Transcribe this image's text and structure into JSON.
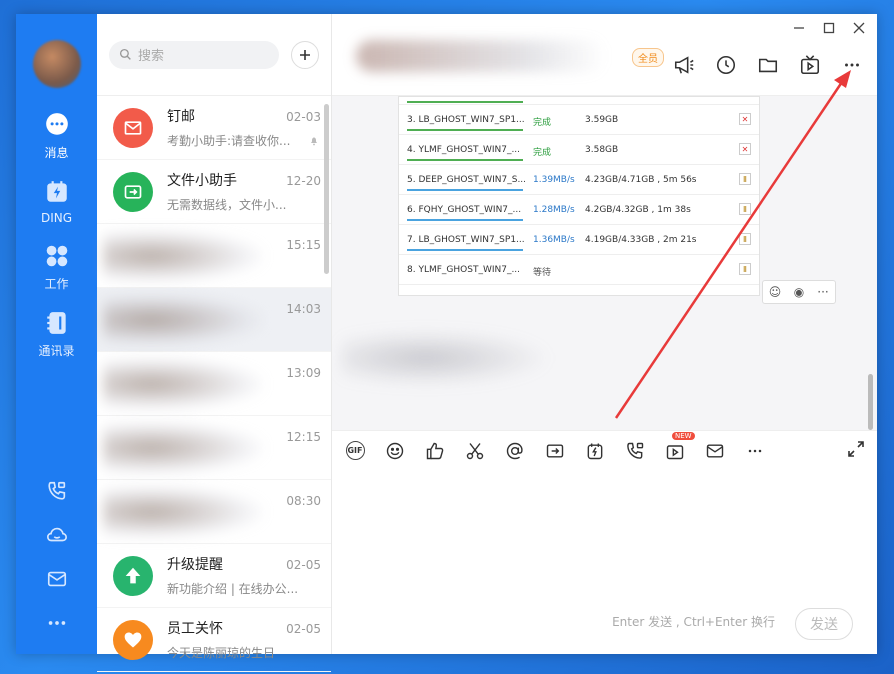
{
  "rail": {
    "items": [
      {
        "label": "消息",
        "icon": "chat-bubble-icon"
      },
      {
        "label": "DING",
        "icon": "ding-icon"
      },
      {
        "label": "工作",
        "icon": "grid-icon"
      },
      {
        "label": "通讯录",
        "icon": "contacts-icon"
      }
    ]
  },
  "search": {
    "placeholder": "搜索"
  },
  "conversations": [
    {
      "name": "钉邮",
      "preview": "考勤小助手:请查收你...",
      "time": "02-03",
      "color": "#f25b4a"
    },
    {
      "name": "文件小助手",
      "preview": "无需数据线，文件小...",
      "time": "12-20",
      "color": "#27b35a"
    },
    {
      "name": "",
      "preview": "",
      "time": "15:15"
    },
    {
      "name": "",
      "preview": "",
      "time": "14:03"
    },
    {
      "name": "",
      "preview": "",
      "time": "13:09"
    },
    {
      "name": "",
      "preview": "",
      "time": "12:15"
    },
    {
      "name": "",
      "preview": "",
      "time": "08:30"
    },
    {
      "name": "升级提醒",
      "preview": "新功能介绍 | 在线办公...",
      "time": "02-05",
      "color": "#28b46e"
    },
    {
      "name": "员工关怀",
      "preview": "今天是陈丽琼的生日",
      "time": "02-05",
      "color": "#f78a1f"
    }
  ],
  "chat": {
    "vip_badge": "全员",
    "downloads": [
      {
        "name": "3. LB_GHOST_WIN7_SP1...",
        "status": "完成",
        "size": "3.59GB",
        "bar": "green",
        "ctrl": "x"
      },
      {
        "name": "4. YLMF_GHOST_WIN7_...",
        "status": "完成",
        "size": "3.58GB",
        "bar": "green",
        "ctrl": "x"
      },
      {
        "name": "5. DEEP_GHOST_WIN7_S...",
        "status": "1.39MB/s",
        "size": "4.23GB/4.71GB , 5m 56s",
        "bar": "blue",
        "ctrl": "p"
      },
      {
        "name": "6. FQHY_GHOST_WIN7_...",
        "status": "1.28MB/s",
        "size": "4.2GB/4.32GB , 1m 38s",
        "bar": "blue",
        "ctrl": "p"
      },
      {
        "name": "7. LB_GHOST_WIN7_SP1...",
        "status": "1.36MB/s",
        "size": "4.19GB/4.33GB , 2m 21s",
        "bar": "blue",
        "ctrl": "p"
      },
      {
        "name": "8. YLMF_GHOST_WIN7_...",
        "status": "等待",
        "size": "",
        "bar": "none",
        "ctrl": "p"
      }
    ],
    "new_badge": "NEW",
    "gif_label": "GIF",
    "hint": "Enter 发送 , Ctrl+Enter 换行",
    "send_label": "发送"
  },
  "colors": {
    "rail": "#1e7cf2",
    "arrow": "#e83a3a"
  }
}
